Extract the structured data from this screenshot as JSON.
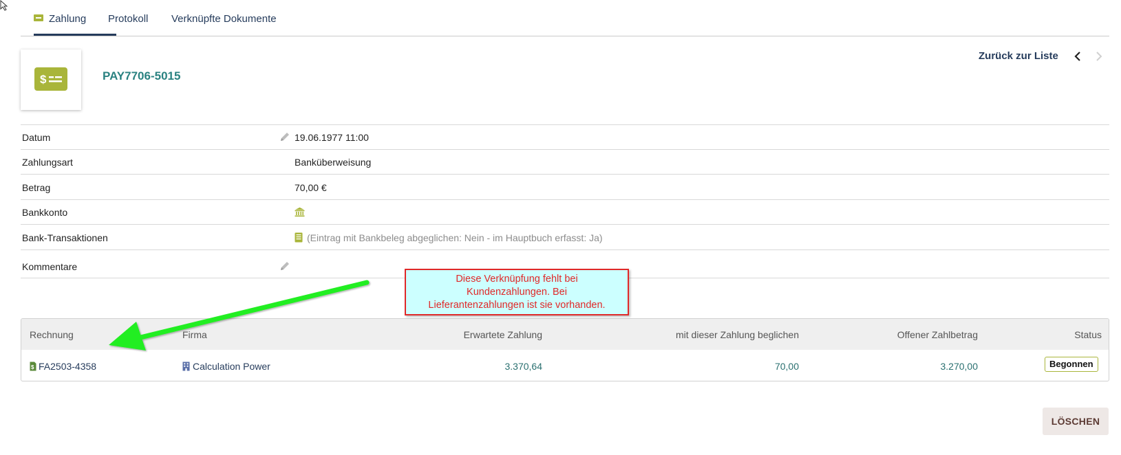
{
  "tabs": [
    {
      "label": "Zahlung",
      "icon": "payment-card-icon",
      "active": true
    },
    {
      "label": "Protokoll",
      "active": false
    },
    {
      "label": "Verknüpfte Dokumente",
      "active": false
    }
  ],
  "header": {
    "reference": "PAY7706-5015",
    "back_label": "Zurück zur Liste",
    "logo_icon": "payment-card-icon"
  },
  "fields": {
    "datum": {
      "label": "Datum",
      "value": "19.06.1977 11:00"
    },
    "zahlungsart": {
      "label": "Zahlungsart",
      "value": "Banküberweisung"
    },
    "betrag": {
      "label": "Betrag",
      "value": "70,00 €"
    },
    "bankkonto": {
      "label": "Bankkonto",
      "icon": "bank-icon"
    },
    "bank_transaktionen": {
      "label": "Bank-Transaktionen",
      "icon": "ledger-icon",
      "value": "(Eintrag mit Bankbeleg abgeglichen: Nein - im Hauptbuch erfasst: Ja)"
    },
    "kommentare": {
      "label": "Kommentare"
    }
  },
  "table": {
    "headers": {
      "rechnung": "Rechnung",
      "firma": "Firma",
      "erwartete": "Erwartete Zahlung",
      "beglichen": "mit dieser Zahlung beglichen",
      "offen": "Offener Zahlbetrag",
      "status": "Status"
    },
    "rows": [
      {
        "rechnung": "FA2503-4358",
        "firma": "Calculation Power",
        "erwartete": "3.370,64",
        "beglichen": "70,00",
        "offen": "3.270,00",
        "status": "Begonnen"
      }
    ]
  },
  "actions": {
    "delete": "LÖSCHEN"
  },
  "annotation": {
    "line1": "Diese Verknüpfung fehlt bei",
    "line2": "Kundenzahlungen. Bei",
    "line3": "Lieferantenzahlungen ist sie vorhanden.",
    "border_color": "#e02828",
    "fill_color": "#ccffff",
    "arrow_color": "#22ee22"
  },
  "colors": {
    "accent_olive": "#a9b53a",
    "navy": "#263c5c",
    "teal": "#2a8281"
  }
}
